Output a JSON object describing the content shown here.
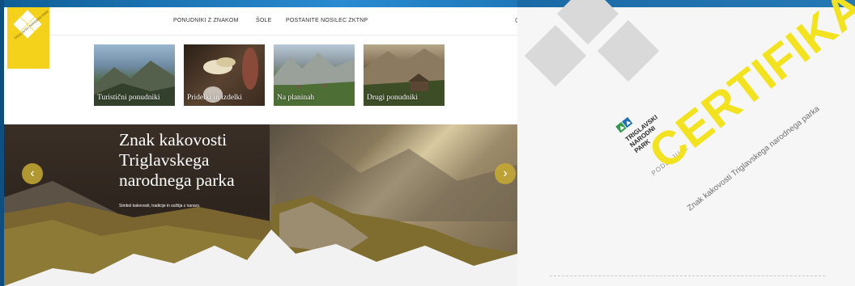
{
  "nav": {
    "items": [
      "PONUDNIKI Z ZNAKOM",
      "ŠOLE",
      "POSTANITE NOSILEC ZKTNP"
    ],
    "extra": "C"
  },
  "logo": {
    "text": "TRIGLAVSKI NARODNI PARK"
  },
  "categories": [
    "Turistični ponudniki",
    "Pridelki in izdelki",
    "Na planinah",
    "Drugi ponudniki"
  ],
  "hero": {
    "title_line1": "Znak kakovosti",
    "title_line2": "Triglavskega",
    "title_line3": "narodnega parka",
    "subtitle": "Simbol kakovosti, tradicije in sožitja z naravo.",
    "prev_icon": "‹",
    "next_icon": "›"
  },
  "certificate": {
    "park_line1": "TRIGLAVSKI",
    "park_line2": "NARODNI",
    "park_line3": "PARK",
    "awards": "PODELJUJE",
    "title": "CERTIFIKAT",
    "subtitle": "Znak kakovosti Triglavskega narodnega parka"
  },
  "colors": {
    "brand_yellow": "#f4d21c",
    "cert_yellow": "#f3e21f",
    "frame_blue": "#1f6fa6"
  }
}
